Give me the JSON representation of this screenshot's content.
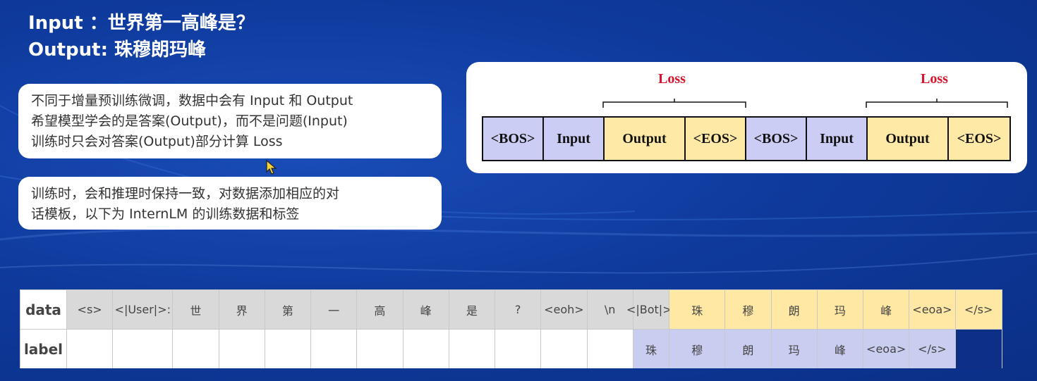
{
  "title": {
    "input_line": "Input  ：世界第一高峰是？",
    "output_line": "Output: 珠穆朗玛峰"
  },
  "notes": {
    "box1": [
      "不同于增量预训练微调，数据中会有 Input 和 Output",
      "希望模型学会的是答案(Output)，而不是问题(Input)",
      "训练时只会对答案(Output)部分计算 Loss"
    ],
    "box2": [
      "训练时，会和推理时保持一致，对数据添加相应的对",
      "话模板，以下为 InternLM 的训练数据和标签"
    ]
  },
  "diagram": {
    "loss_label": "Loss",
    "segments": [
      {
        "text": "<BOS>",
        "color": "blue"
      },
      {
        "text": "Input",
        "color": "blue"
      },
      {
        "text": "Output",
        "color": "yellow"
      },
      {
        "text": "<EOS>",
        "color": "yellow"
      },
      {
        "text": "<BOS>",
        "color": "blue"
      },
      {
        "text": "Input",
        "color": "blue"
      },
      {
        "text": "Output",
        "color": "yellow"
      },
      {
        "text": "<EOS>",
        "color": "yellow"
      }
    ]
  },
  "table": {
    "row_headers": [
      "data",
      "label"
    ],
    "data": [
      "<s>",
      "<|User|>:",
      "世",
      "界",
      "第",
      "一",
      "高",
      "峰",
      "是",
      "?",
      "<eoh>",
      "\\n",
      "<|Bot|>:",
      "珠",
      "穆",
      "朗",
      "玛",
      "峰",
      "<eoa>",
      "</s>"
    ],
    "label": [
      "",
      "",
      "",
      "",
      "",
      "",
      "",
      "",
      "",
      "",
      "",
      "",
      "珠",
      "穆",
      "朗",
      "玛",
      "峰",
      "<eoa>",
      "</s>",
      ""
    ]
  },
  "colors": {
    "background": "#0f3b9e",
    "loss": "#d8142c",
    "input_segment": "#cbcdf5",
    "output_segment": "#ffe9a6",
    "data_prompt_cell": "#d9d9d9",
    "data_answer_cell": "#ffe8a3",
    "label_cell": "#c9cdf0"
  }
}
